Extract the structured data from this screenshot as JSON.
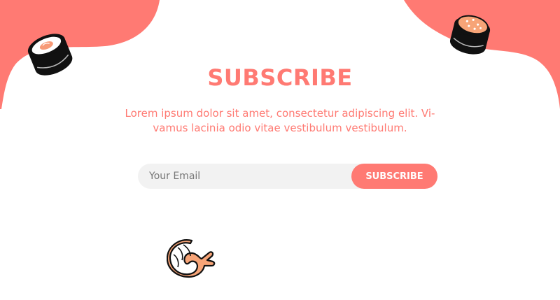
{
  "colors": {
    "accent": "#FF7A73",
    "input_background": "#F2F2F2",
    "background": "#FFFFFF"
  },
  "hero": {
    "title": "SUBSCRIBE",
    "description_line1": "Lorem ipsum dolor sit amet, consectetur adipiscing elit. Vi-",
    "description_line2": "vamus lacinia odio vitae vestibulum vestibulum."
  },
  "form": {
    "email_placeholder": "Your Email",
    "email_value": "",
    "button_label": "SUBSCRIBE"
  },
  "decorations": {
    "left_icon": "sushi-roll-icon",
    "right_icon": "salmon-sushi-icon",
    "bottom_icon": "shrimp-icon"
  }
}
